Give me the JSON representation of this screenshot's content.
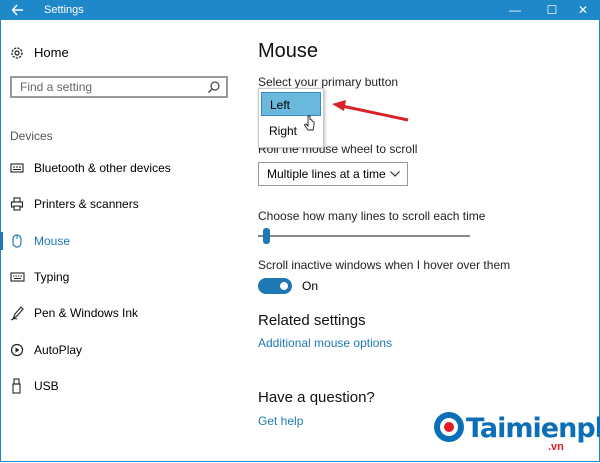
{
  "window": {
    "title": "Settings",
    "controls": {
      "minimize": "—",
      "maximize": "☐",
      "close": "✕"
    },
    "accent_color": "#1e88c8"
  },
  "sidebar": {
    "home_label": "Home",
    "search_placeholder": "Find a setting",
    "section_label": "Devices",
    "items": [
      {
        "label": "Bluetooth & other devices",
        "icon": "bluetooth-devices-icon"
      },
      {
        "label": "Printers & scanners",
        "icon": "printer-icon"
      },
      {
        "label": "Mouse",
        "icon": "mouse-icon",
        "selected": true
      },
      {
        "label": "Typing",
        "icon": "keyboard-icon"
      },
      {
        "label": "Pen & Windows Ink",
        "icon": "pen-icon"
      },
      {
        "label": "AutoPlay",
        "icon": "autoplay-icon"
      },
      {
        "label": "USB",
        "icon": "usb-icon"
      }
    ]
  },
  "main": {
    "title": "Mouse",
    "primary_button_label": "Select your primary button",
    "primary_button_options": [
      "Left",
      "Right"
    ],
    "primary_button_highlighted": "Left",
    "scroll_wheel_label": "Roll the mouse wheel to scroll",
    "scroll_wheel_value": "Multiple lines at a time",
    "lines_label": "Choose how many lines to scroll each time",
    "lines_slider_fraction": 0.03,
    "inactive_scroll_label": "Scroll inactive windows when I hover over them",
    "inactive_scroll_state": "On",
    "related_heading": "Related settings",
    "related_link": "Additional mouse options",
    "question_heading": "Have a question?",
    "help_link": "Get help"
  },
  "watermark": {
    "brand": "Taimienphi",
    "domain": ".vn"
  }
}
